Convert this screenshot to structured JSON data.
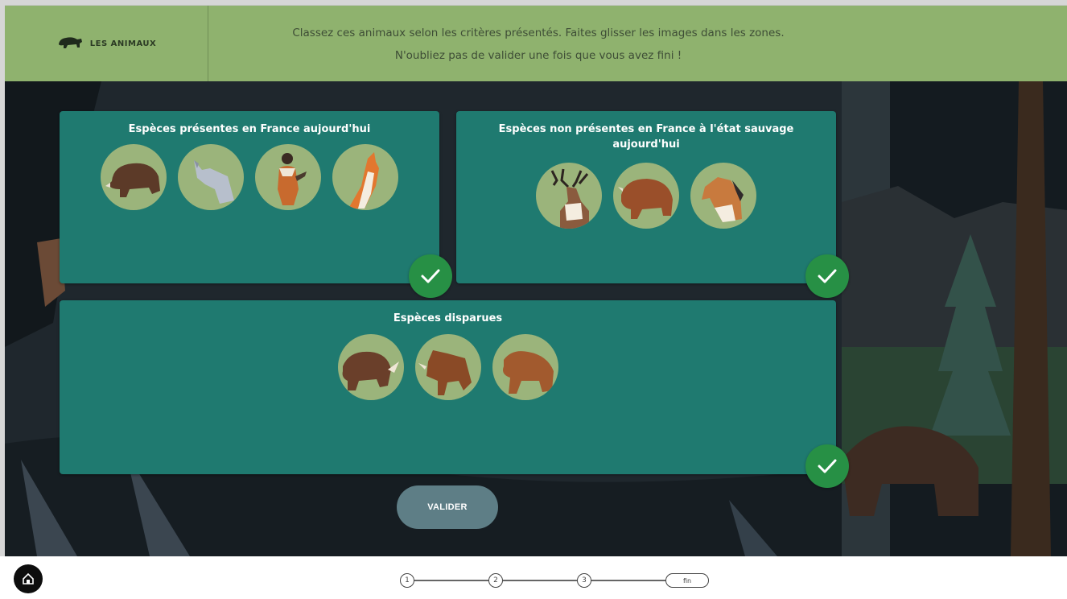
{
  "header": {
    "brand_label": "LES ANIMAUX",
    "instruction_line1": "Classez ces animaux selon les critères présentés. Faites glisser les images dans les zones.",
    "instruction_line2": "N'oubliez pas de valider une fois que vous avez fini !"
  },
  "zones": [
    {
      "title": "Espèces présentes en France aujourd'hui",
      "animals": [
        "wild-boar",
        "wolf",
        "human",
        "chamois"
      ],
      "validated": true
    },
    {
      "title": "Espèces non présentes en France à l'état sauvage aujourd'hui",
      "animals": [
        "reindeer",
        "bison",
        "horse"
      ],
      "validated": true
    },
    {
      "title": "Espèces disparues",
      "animals": [
        "woolly-rhinoceros",
        "aurochs",
        "cave-bear"
      ],
      "validated": true
    }
  ],
  "valider_label": "VALIDER",
  "progress": {
    "steps": [
      "1",
      "2",
      "3"
    ],
    "final_label": "fin",
    "current": "fin"
  },
  "colors": {
    "header": "#8fb26e",
    "zone": "#1f7a70",
    "check": "#279045",
    "animal_bg": "#9bb47b",
    "valider": "#5e7e86"
  }
}
